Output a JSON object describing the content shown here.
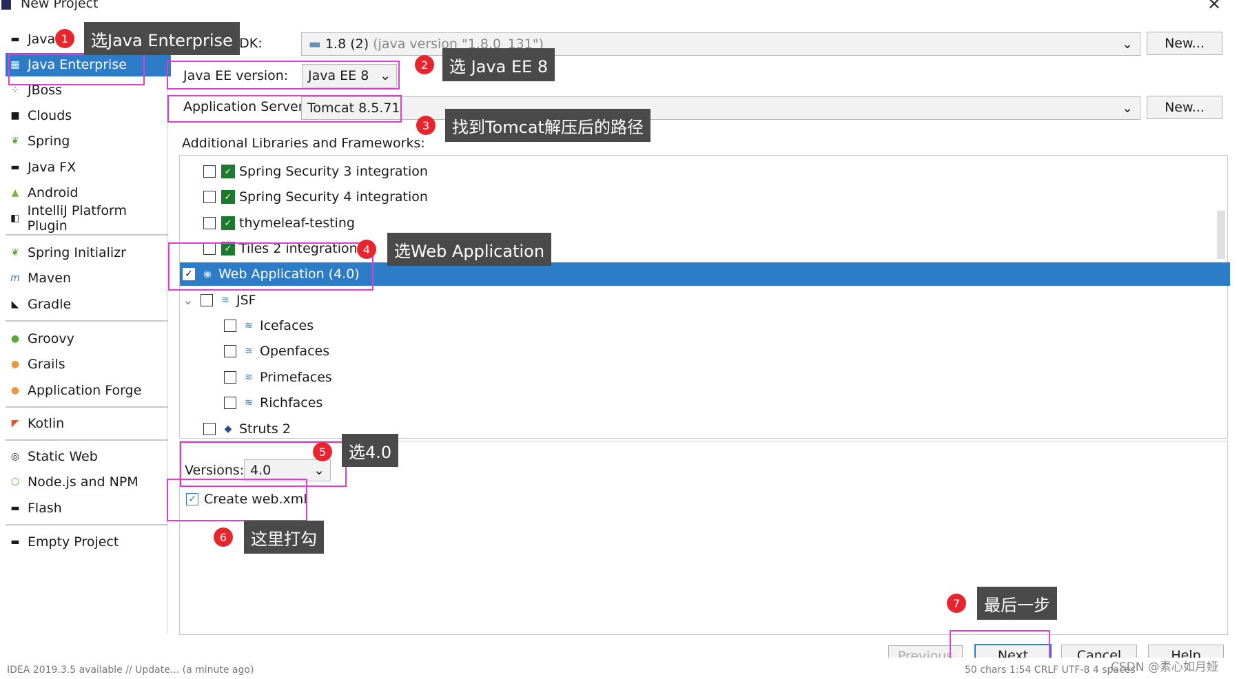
{
  "window": {
    "title": "New Project"
  },
  "sidebar": {
    "items": [
      {
        "label": "Java",
        "icon": "folder-icon"
      },
      {
        "label": "Java Enterprise",
        "icon": "enterprise-icon",
        "selected": true
      },
      {
        "label": "JBoss",
        "icon": "jboss-icon"
      },
      {
        "label": "Clouds",
        "icon": "cloud-icon"
      },
      {
        "label": "Spring",
        "icon": "spring-leaf-icon"
      },
      {
        "label": "Java FX",
        "icon": "folder-icon"
      },
      {
        "label": "Android",
        "icon": "android-icon"
      },
      {
        "label": "IntelliJ Platform Plugin",
        "icon": "plugin-icon"
      },
      {
        "label": "Spring Initializr",
        "icon": "spring-initializr-icon"
      },
      {
        "label": "Maven",
        "icon": "maven-icon"
      },
      {
        "label": "Gradle",
        "icon": "gradle-icon"
      },
      {
        "label": "Groovy",
        "icon": "groovy-icon"
      },
      {
        "label": "Grails",
        "icon": "grails-icon"
      },
      {
        "label": "Application Forge",
        "icon": "grails-icon"
      },
      {
        "label": "Kotlin",
        "icon": "kotlin-icon"
      },
      {
        "label": "Static Web",
        "icon": "globe-icon"
      },
      {
        "label": "Node.js and NPM",
        "icon": "nodejs-icon"
      },
      {
        "label": "Flash",
        "icon": "flash-icon"
      },
      {
        "label": "Empty Project",
        "icon": "folder-icon"
      }
    ]
  },
  "sdk": {
    "label": "Project SDK:",
    "value": "1.8 (2)",
    "detail": "(java version \"1.8.0_131\")",
    "new_label": "New..."
  },
  "javaee": {
    "label": "Java EE version:",
    "value": "Java EE 8"
  },
  "server": {
    "label": "Application Server:",
    "value": "Tomcat 8.5.71",
    "new_label": "New..."
  },
  "libraries": {
    "label": "Additional Libraries and Frameworks:",
    "items": [
      {
        "label": "Spring Security 3 integration",
        "checked": false
      },
      {
        "label": "Spring Security 4 integration",
        "checked": false
      },
      {
        "label": "thymeleaf-testing",
        "checked": false
      },
      {
        "label": "Tiles 2 integration",
        "checked": false
      },
      {
        "label": "Web Application (4.0)",
        "checked": true,
        "selected": true
      },
      {
        "label": "JSF",
        "checked": false
      },
      {
        "label": "Icefaces",
        "checked": false
      },
      {
        "label": "Openfaces",
        "checked": false
      },
      {
        "label": "Primefaces",
        "checked": false
      },
      {
        "label": "Richfaces",
        "checked": false
      },
      {
        "label": "Struts 2",
        "checked": false
      }
    ]
  },
  "versions": {
    "label": "Versions:",
    "value": "4.0"
  },
  "create_webxml": {
    "label": "Create web.xml",
    "checked": true
  },
  "buttons": {
    "previous": "Previous",
    "next": "Next",
    "cancel": "Cancel",
    "help": "Help"
  },
  "annotations": [
    {
      "num": "1",
      "text": "选Java Enterprise"
    },
    {
      "num": "2",
      "text": "选 Java EE 8"
    },
    {
      "num": "3",
      "text": "找到Tomcat解压后的路径"
    },
    {
      "num": "4",
      "text": "选Web Application"
    },
    {
      "num": "5",
      "text": "选4.0"
    },
    {
      "num": "6",
      "text": "这里打勾"
    },
    {
      "num": "7",
      "text": "最后一步"
    }
  ],
  "watermark": "CSDN @素心如月娅",
  "statusbar": {
    "left": "IDEA 2019.3.5 available // Update... (a minute ago)",
    "right": "50 chars   1:54   CRLF   UTF-8   4 spaces"
  },
  "colors": {
    "selection": "#2d7cc8",
    "annotation_box": "#e23ad8",
    "badge": "#e6262c",
    "callout_bg": "#4a4a4a"
  }
}
